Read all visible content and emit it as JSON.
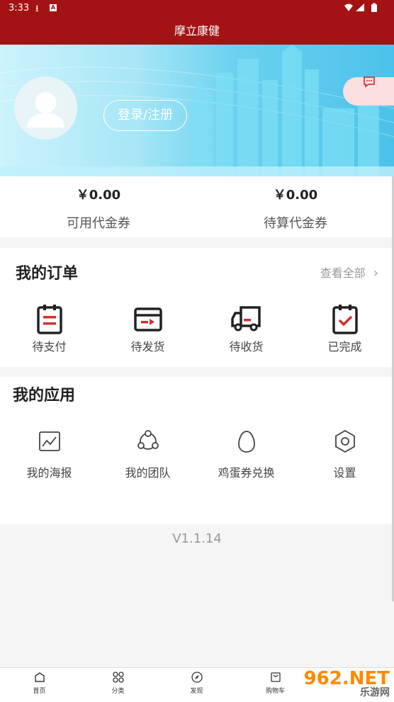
{
  "status_bar": {
    "time": "3:33"
  },
  "header": {
    "title": "摩立康健"
  },
  "profile": {
    "login_label": "登录/注册"
  },
  "coupons": [
    {
      "amount": "￥0.00",
      "label": "可用代金券"
    },
    {
      "amount": "￥0.00",
      "label": "待算代金券"
    }
  ],
  "orders": {
    "title": "我的订单",
    "view_all": "查看全部",
    "items": [
      {
        "label": "待支付",
        "icon": "clipboard-pending-icon"
      },
      {
        "label": "待发货",
        "icon": "box-ship-icon"
      },
      {
        "label": "待收货",
        "icon": "truck-icon"
      },
      {
        "label": "已完成",
        "icon": "clipboard-check-icon"
      }
    ]
  },
  "apps": {
    "title": "我的应用",
    "items": [
      {
        "label": "我的海报",
        "icon": "poster-icon"
      },
      {
        "label": "我的团队",
        "icon": "team-icon"
      },
      {
        "label": "鸡蛋券兑换",
        "icon": "egg-icon"
      },
      {
        "label": "设置",
        "icon": "settings-hex-icon"
      }
    ]
  },
  "version": "V1.1.14",
  "tabbar": [
    {
      "label": "首页",
      "icon": "home-icon"
    },
    {
      "label": "分类",
      "icon": "category-icon"
    },
    {
      "label": "发现",
      "icon": "compass-icon"
    },
    {
      "label": "购物车",
      "icon": "cart-icon"
    }
  ],
  "watermark": {
    "brand": "962.NET",
    "sub": "乐游网"
  },
  "colors": {
    "brand_red": "#a31313",
    "accent_red": "#d32f2f"
  }
}
